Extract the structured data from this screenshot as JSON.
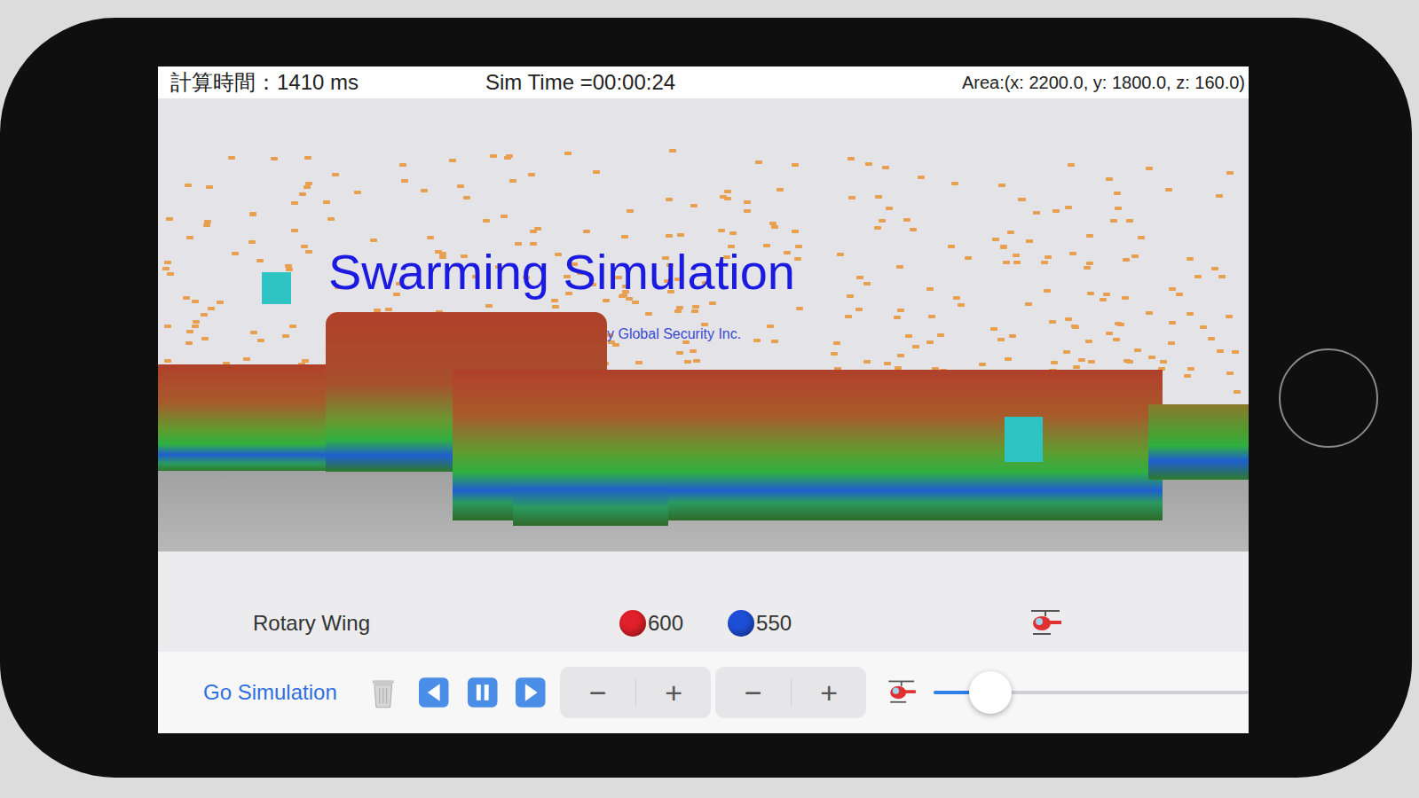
{
  "status": {
    "calc_time": "計算時間：1410 ms",
    "sim_time": "Sim Time =00:00:24",
    "area": "Area:(x: 2200.0, y: 1800.0, z: 160.0)"
  },
  "scene": {
    "title": "Swarming Simulation",
    "subtitle": "y Global Security Inc."
  },
  "info": {
    "mode": "Rotary Wing",
    "teams": [
      {
        "count": "600",
        "color": "#e0202a"
      },
      {
        "count": "550",
        "color": "#1e4fd8"
      }
    ]
  },
  "toolbar": {
    "go": "Go Simulation",
    "steppers": [
      {
        "minus": "−",
        "plus": "+"
      },
      {
        "minus": "−",
        "plus": "+"
      }
    ],
    "slider": {
      "level": 0.18
    }
  }
}
